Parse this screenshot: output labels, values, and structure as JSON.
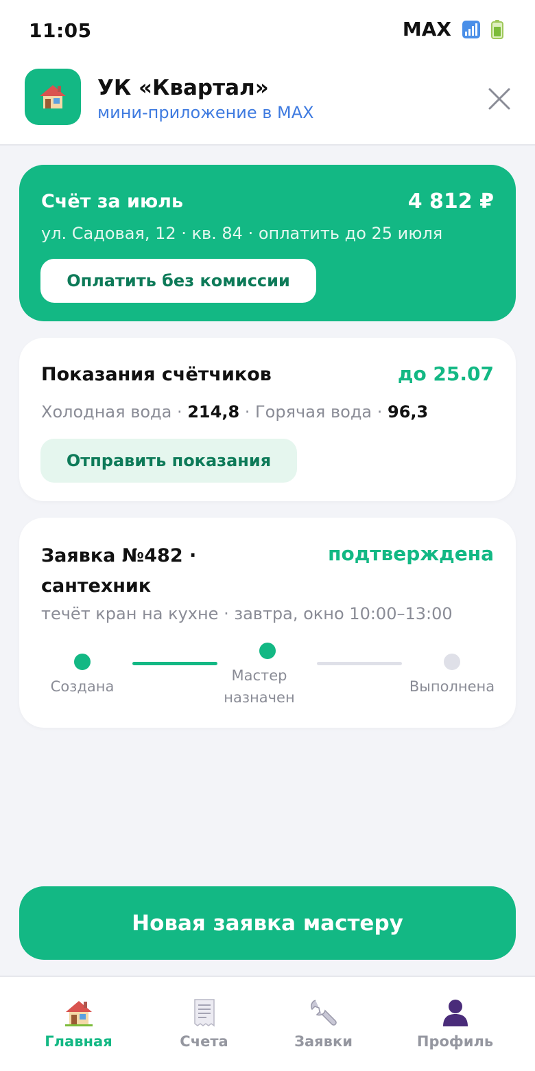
{
  "status_bar": {
    "time": "11:05",
    "carrier": "MAX",
    "icons": [
      "signal-icon",
      "battery-icon"
    ]
  },
  "header": {
    "logo_icon": "house-icon",
    "title": "УК «Квартал»",
    "subtitle": "мини-приложение в MAX",
    "close_icon": "close-icon"
  },
  "bill": {
    "title": "Счёт за июль",
    "amount": "4 812 ₽",
    "details": "ул. Садовая, 12 · кв. 84 · оплатить до 25 июля",
    "pay_label": "Оплатить без комиссии"
  },
  "meters": {
    "title": "Показания счётчиков",
    "deadline": "до 25.07",
    "cold_label": "Холодная вода · ",
    "cold_value": "214,8",
    "separator": " · ",
    "hot_label": "Горячая вода · ",
    "hot_value": "96,3",
    "send_label": "Отправить показания"
  },
  "request": {
    "title": "Заявка №482 · сантехник",
    "status": "подтверждена",
    "details": "течёт кран на кухне · завтра, окно 10:00–13:00",
    "steps": [
      {
        "label": "Создана",
        "done": true
      },
      {
        "label": "Мастер назначен",
        "done": true
      },
      {
        "label": "Выполнена",
        "done": false
      }
    ]
  },
  "new_request_label": "Новая заявка мастеру",
  "tabs": [
    {
      "label": "Главная",
      "icon": "house-icon",
      "active": true
    },
    {
      "label": "Счета",
      "icon": "receipt-icon",
      "active": false
    },
    {
      "label": "Заявки",
      "icon": "wrench-icon",
      "active": false
    },
    {
      "label": "Профиль",
      "icon": "person-icon",
      "active": false
    }
  ],
  "colors": {
    "accent": "#13b884",
    "accent_dark": "#0d7a58",
    "link": "#3f7be0",
    "background": "#f3f4f8",
    "muted": "#8a8c96",
    "inactive": "#dfe0e8"
  }
}
